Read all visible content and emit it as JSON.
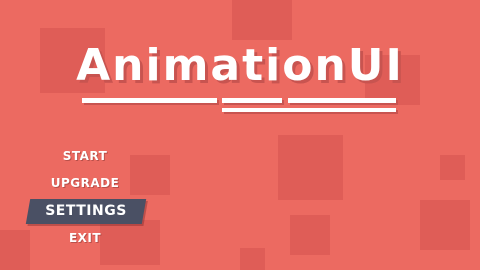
{
  "logo": {
    "title": "AnimationUI"
  },
  "menu": {
    "items": [
      {
        "label": "START"
      },
      {
        "label": "UPGRADE"
      },
      {
        "label": "SETTINGS",
        "selected": true
      },
      {
        "label": "EXIT"
      }
    ]
  },
  "colors": {
    "background": "#ec6a61",
    "highlight": "#4a5064",
    "text": "#ffffff"
  }
}
